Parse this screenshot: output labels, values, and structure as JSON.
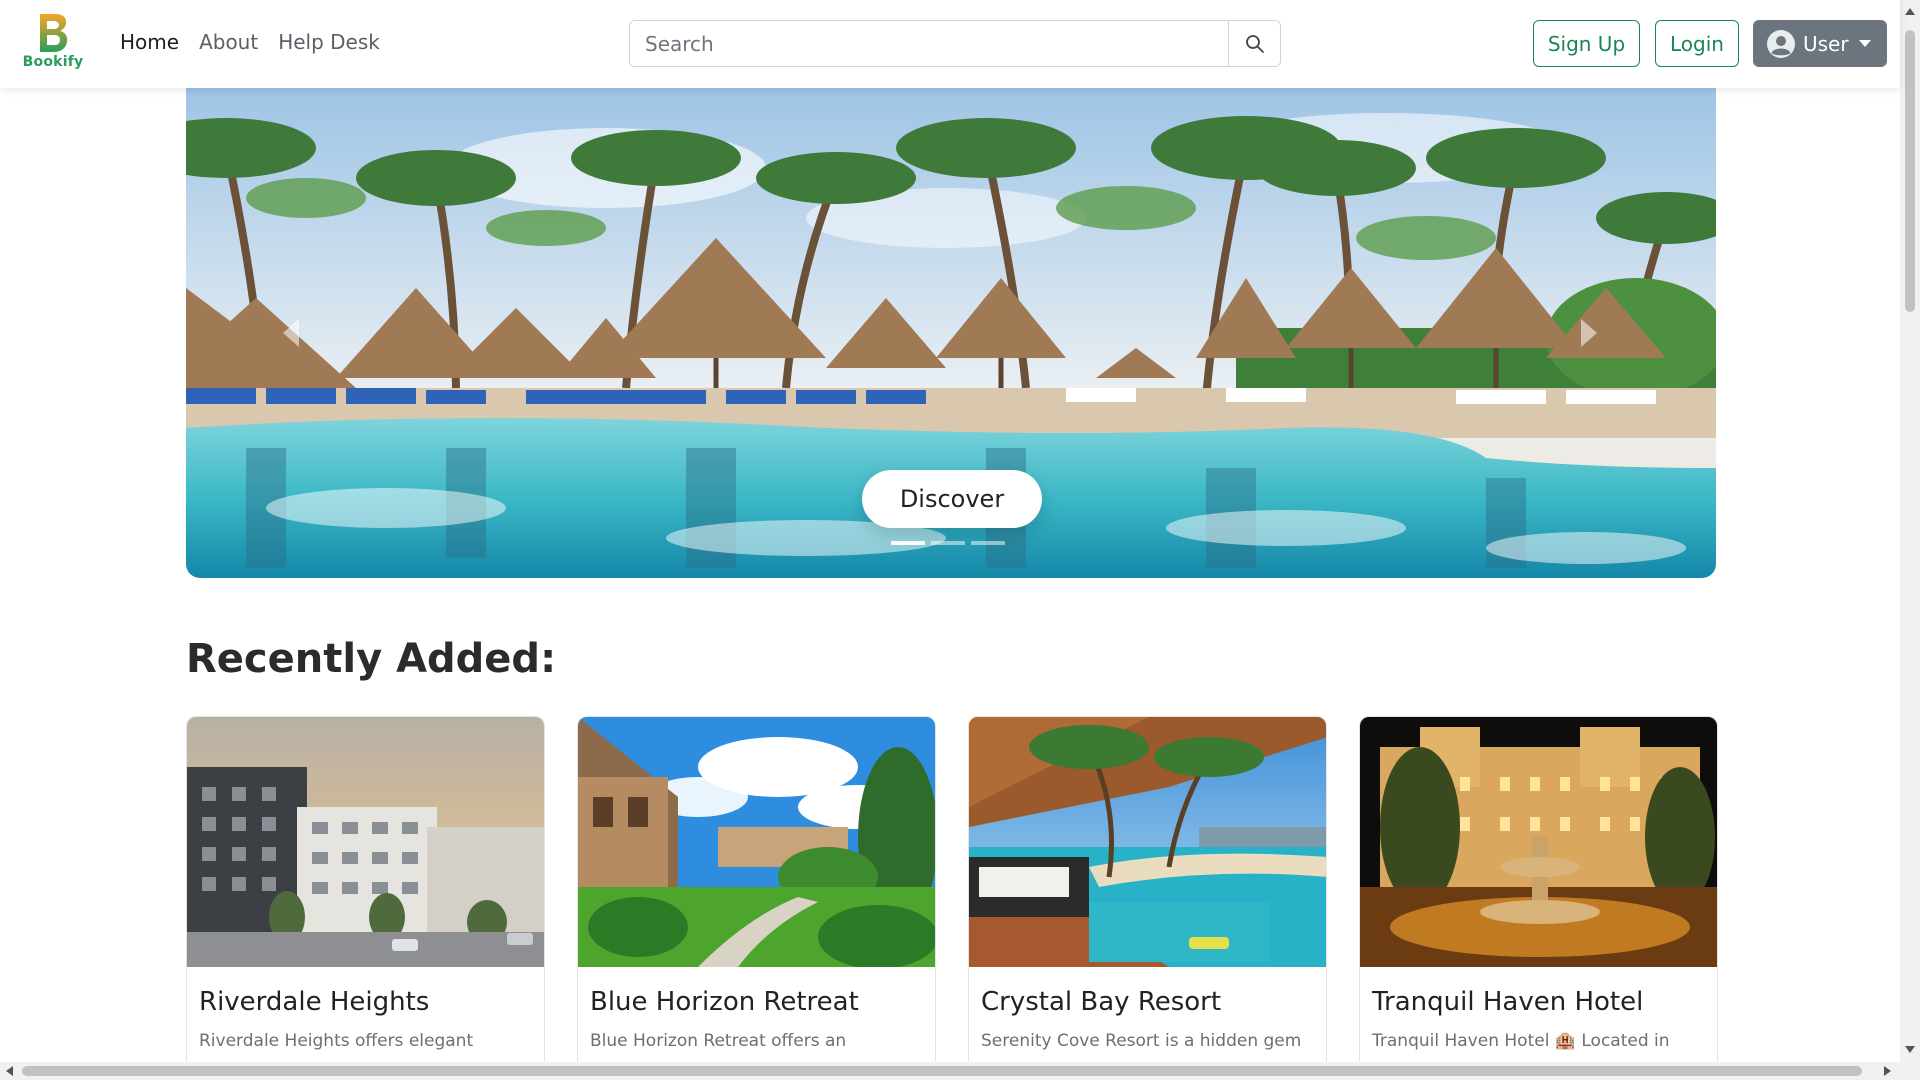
{
  "brand": {
    "name": "Bookify",
    "icon": "bookify-b-logo",
    "color": "#2a9d5c"
  },
  "nav": {
    "links": [
      {
        "label": "Home",
        "active": true
      },
      {
        "label": "About",
        "active": false
      },
      {
        "label": "Help Desk",
        "active": false
      }
    ]
  },
  "search": {
    "placeholder": "Search",
    "value": "",
    "icon": "search-icon"
  },
  "auth": {
    "signup_label": "Sign Up",
    "login_label": "Login",
    "user_label": "User",
    "accent": "#198754"
  },
  "hero": {
    "button_label": "Discover",
    "slides_count": 3,
    "active_slide": 1,
    "prev_icon": "chevron-left-icon",
    "next_icon": "chevron-right-icon"
  },
  "recent": {
    "title": "Recently Added:",
    "cards": [
      {
        "title": "Riverdale Heights",
        "description": "Riverdale Heights offers elegant"
      },
      {
        "title": "Blue Horizon Retreat",
        "description": "Blue Horizon Retreat offers an"
      },
      {
        "title": "Crystal Bay Resort",
        "description": "Serenity Cove Resort is a hidden gem"
      },
      {
        "title": "Tranquil Haven Hotel",
        "description": "Tranquil Haven Hotel 🏨 Located in"
      }
    ]
  }
}
